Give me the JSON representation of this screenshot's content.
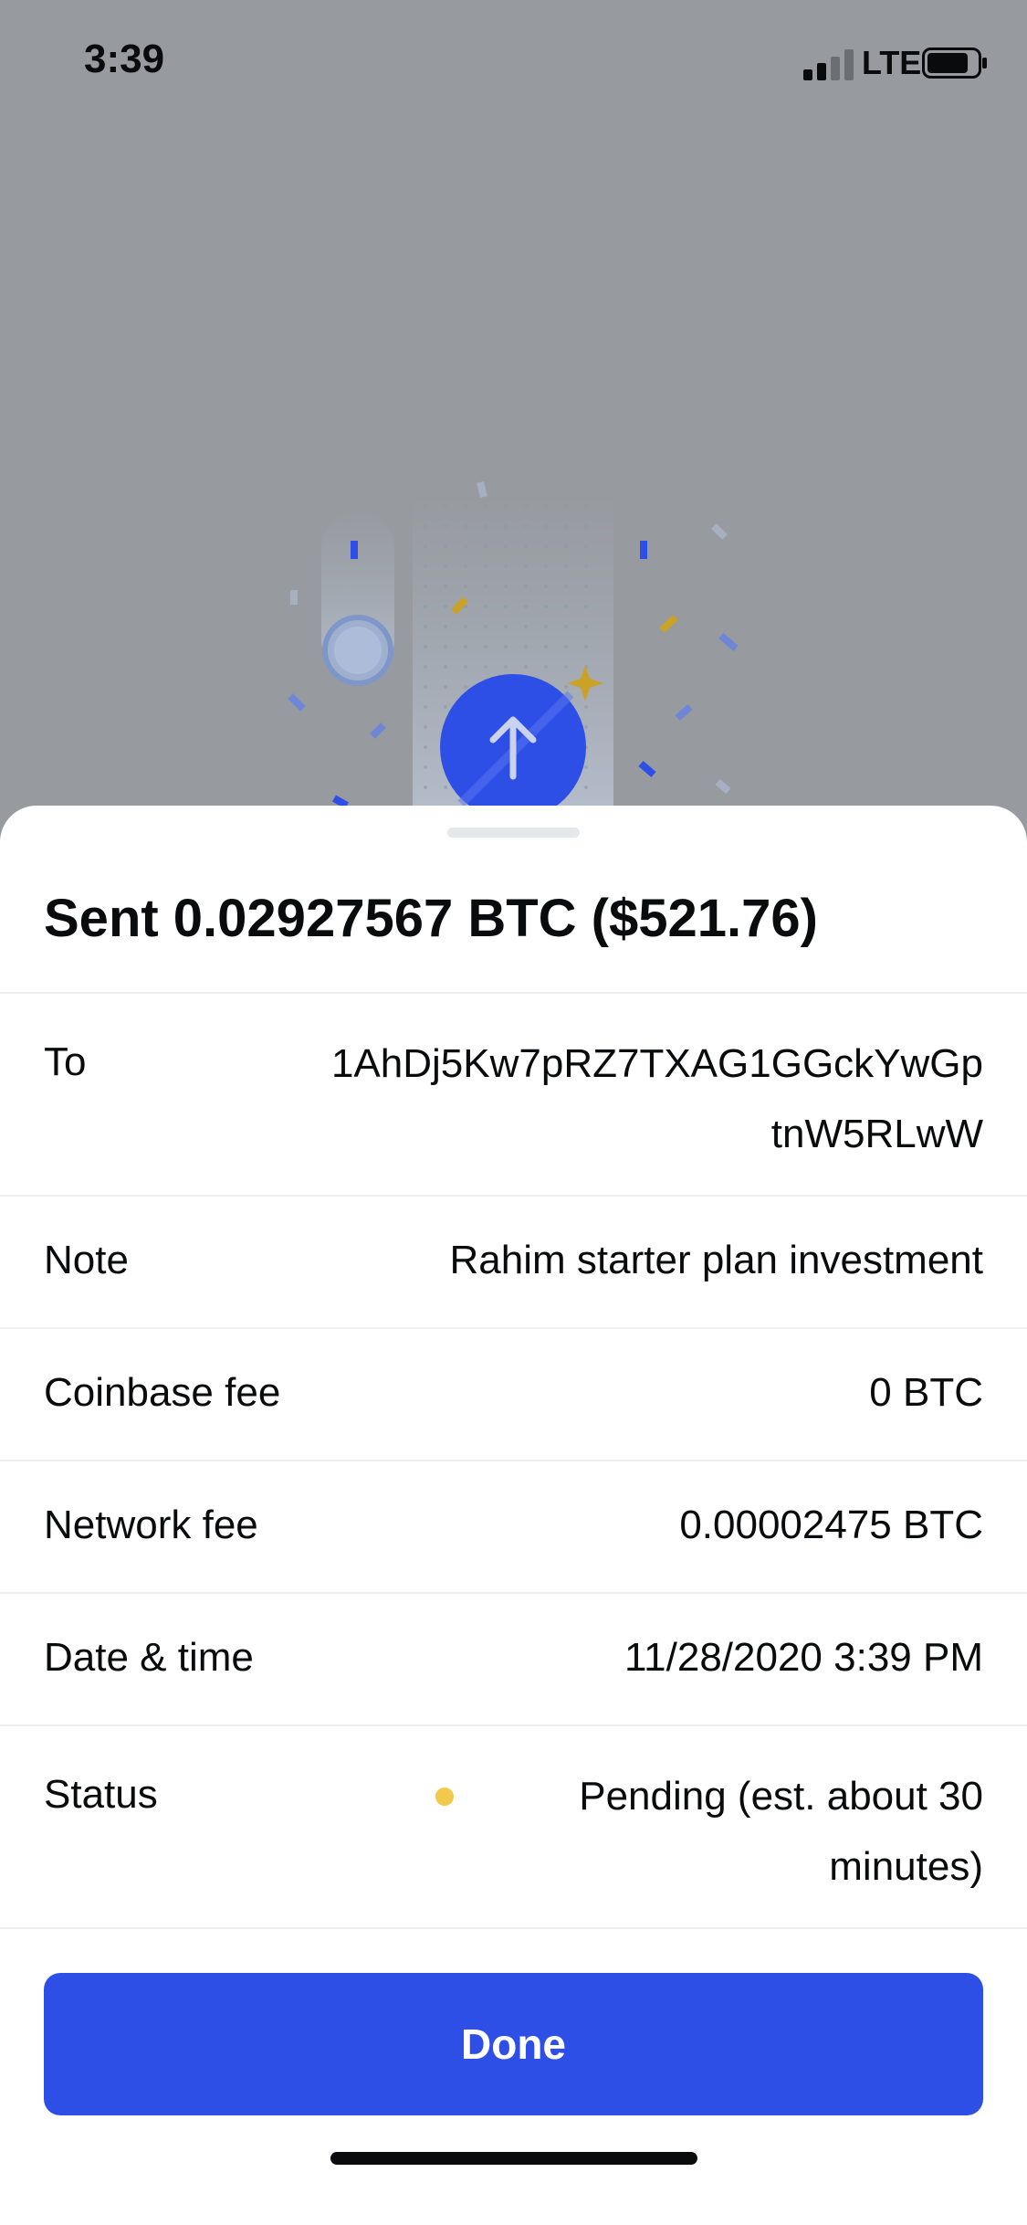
{
  "status_bar": {
    "time": "3:39",
    "network": "LTE",
    "icons": [
      "signal-icon",
      "battery-icon"
    ]
  },
  "illustration": {
    "icon": "arrow-up-icon",
    "accent_color": "#2e4fe6",
    "confetti_colors": [
      "#2e4fe6",
      "#c9a227",
      "#6f86d6"
    ]
  },
  "transaction": {
    "title": "Sent 0.02927567 BTC ($521.76)",
    "rows": [
      {
        "label": "To",
        "value": "1AhDj5Kw7pRZ7TXAG1GGckYwGptnW5RLwW"
      },
      {
        "label": "Note",
        "value": "Rahim starter plan investment"
      },
      {
        "label": "Coinbase fee",
        "value": "0 BTC"
      },
      {
        "label": "Network fee",
        "value": "0.00002475 BTC"
      },
      {
        "label": "Date & time",
        "value": "11/28/2020 3:39 PM"
      },
      {
        "label": "Status",
        "value": "Pending (est. about 30 minutes)",
        "status_color": "#f2c94c"
      }
    ]
  },
  "actions": {
    "done_label": "Done",
    "done_color": "#2e4fe6"
  }
}
